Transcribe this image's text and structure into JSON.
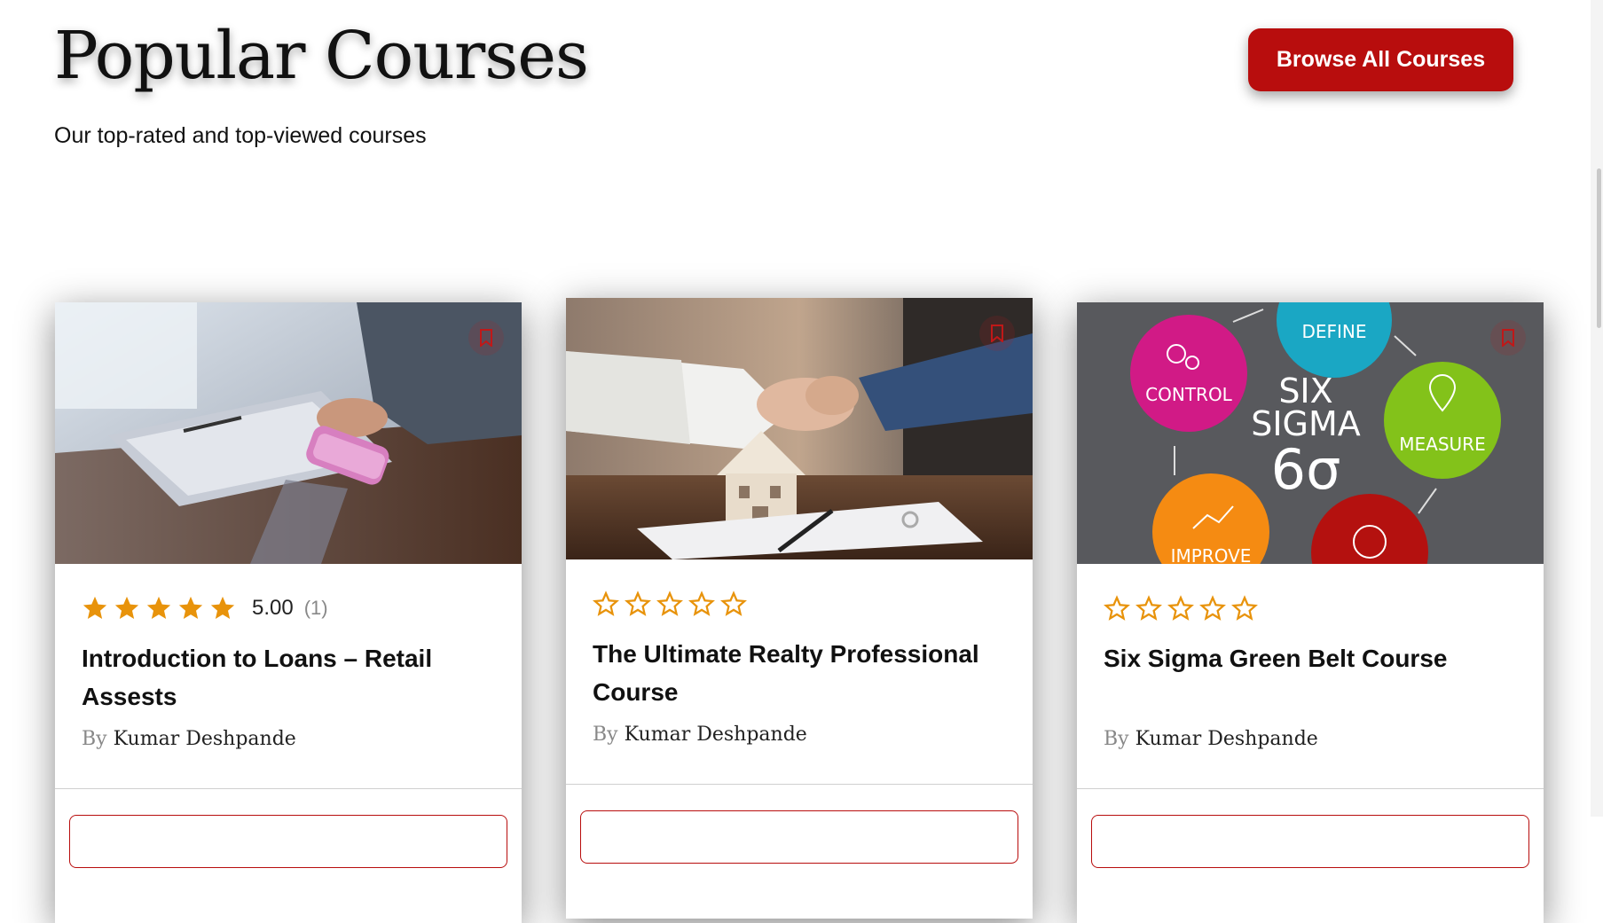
{
  "header": {
    "title": "Popular Courses",
    "subtitle": "Our top-rated and top-viewed courses",
    "browse_label": "Browse All Courses"
  },
  "colors": {
    "brand_red": "#b80d0d",
    "star_orange": "#e8930b"
  },
  "courses": [
    {
      "title": "Introduction to Loans – Retail Assests",
      "author_prefix": "By",
      "author": "Kumar Deshpande",
      "rating_stars": 5,
      "rating_value": "5.00",
      "rating_count": "(1)",
      "image": "loan-cash-handover-photo"
    },
    {
      "title": "The Ultimate Realty Professional Course",
      "author_prefix": "By",
      "author": "Kumar Deshpande",
      "rating_stars": 0,
      "image": "realty-handshake-house-photo"
    },
    {
      "title": "Six Sigma Green Belt Course",
      "author_prefix": "By",
      "author": "Kumar Deshpande",
      "rating_stars": 0,
      "image": "six-sigma-dmaic-graphic",
      "image_text": {
        "define": "DEFINE",
        "control": "CONTROL",
        "measure": "MEASURE",
        "improve": "IMPROVE",
        "six": "SIX",
        "sigma": "SIGMA",
        "symbol": "6σ"
      }
    }
  ]
}
